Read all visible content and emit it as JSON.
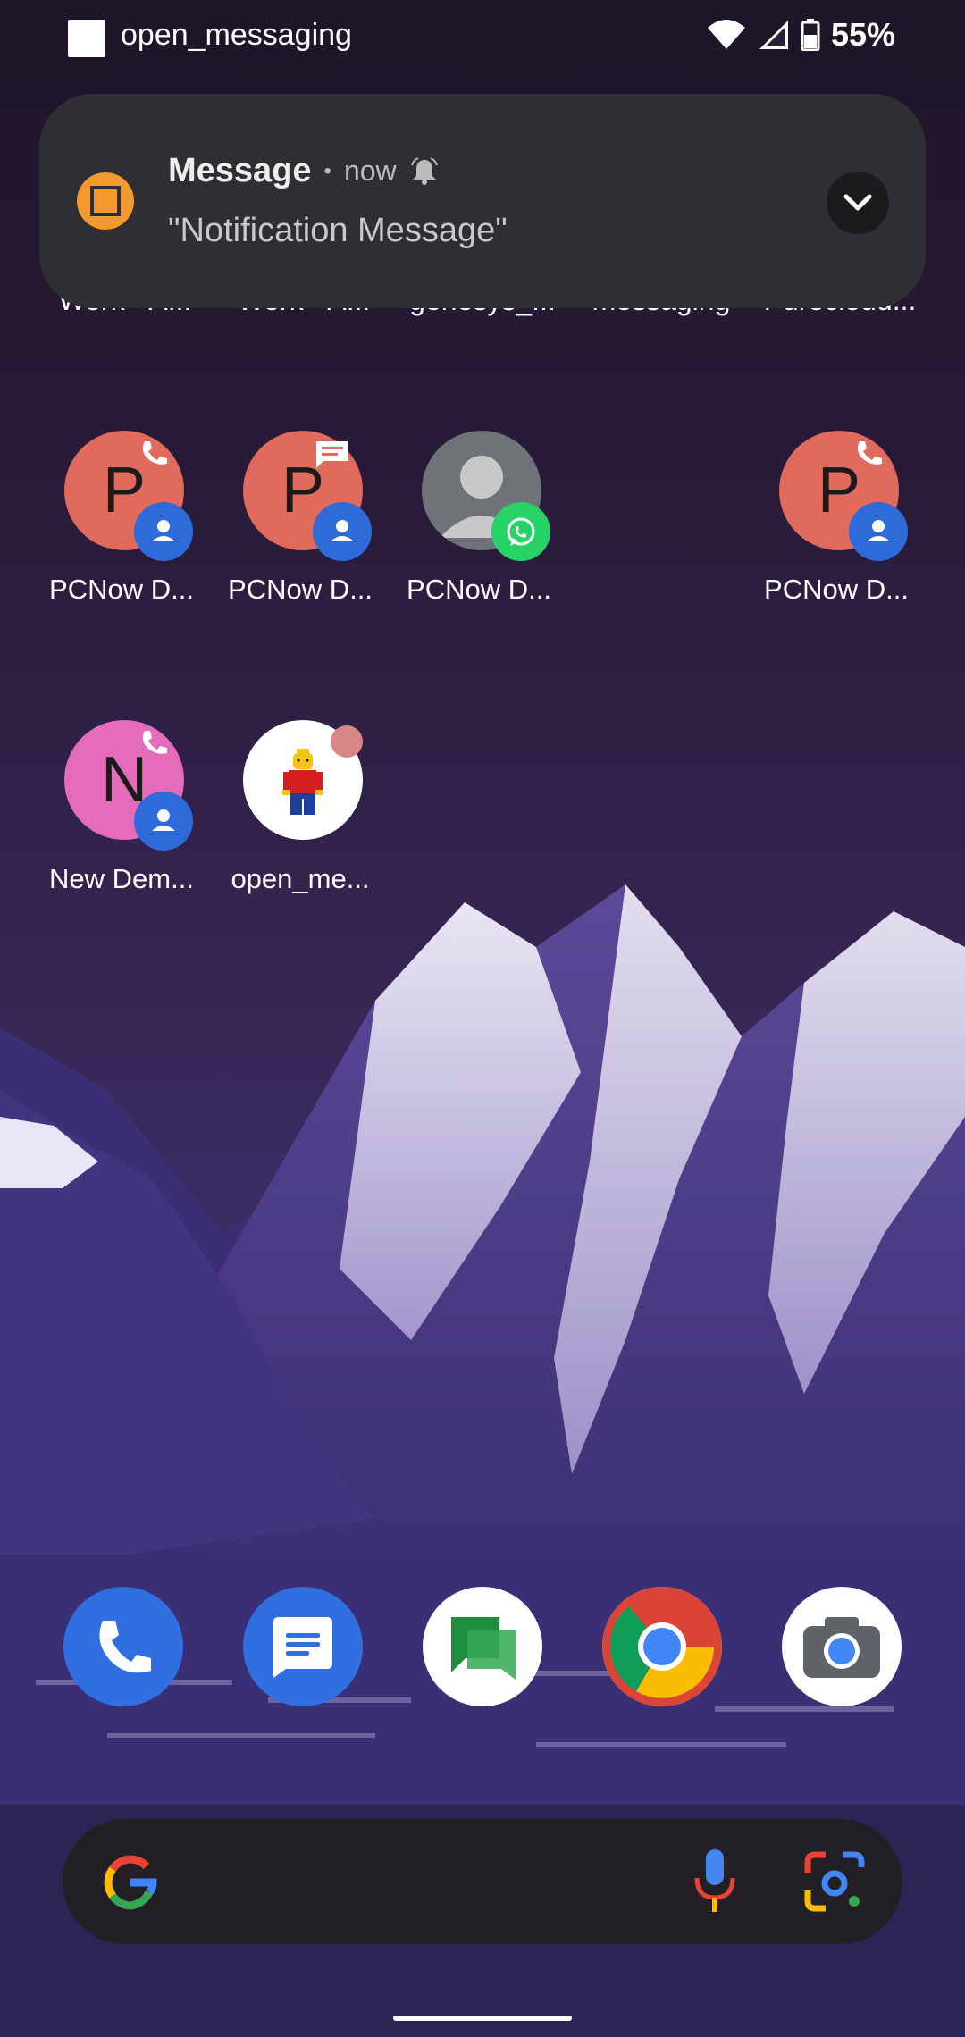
{
  "status_bar": {
    "app_name": "open_messaging",
    "battery": "55%",
    "icons": [
      "app-square-icon",
      "wifi-icon",
      "cellular-icon",
      "battery-icon"
    ]
  },
  "notification": {
    "title": "Message",
    "separator": "•",
    "time": "now",
    "body": "\"Notification Message\"",
    "icon_color": "#f29a2e",
    "icons": [
      "notification-app-icon",
      "bell-icon",
      "chevron-down-icon"
    ]
  },
  "hidden_row": {
    "labels": [
      "Work - A...",
      "Work - A...",
      "genesys_...",
      "messaging",
      "Purecloud..."
    ]
  },
  "home_grid": {
    "row1": [
      {
        "letter": "P",
        "label": "PCNow D...",
        "color": "#e06a5c",
        "badge": "phone"
      },
      {
        "letter": "P",
        "label": "PCNow D...",
        "color": "#e06a5c",
        "badge": "message"
      },
      {
        "letter": "",
        "label": "PCNow D...",
        "color": "#6e7378",
        "badge": "whatsapp"
      },
      {
        "letter": "P",
        "label": "PCNow D...",
        "color": "#e06a5c",
        "badge": "phone"
      }
    ],
    "row2": [
      {
        "letter": "N",
        "label": "New Dem...",
        "color": "#e56bbb",
        "badge": "phone"
      },
      {
        "letter": "",
        "label": "open_me...",
        "color": "#ffffff",
        "badge": "notification-dot"
      }
    ]
  },
  "dock": {
    "apps": [
      "phone-app-icon",
      "messages-app-icon",
      "google-chat-app-icon",
      "chrome-app-icon",
      "camera-app-icon"
    ]
  },
  "search_bar": {
    "icons": [
      "google-g-icon",
      "microphone-icon",
      "google-lens-icon"
    ]
  },
  "colors": {
    "accent_blue": "#2f6bd8",
    "whatsapp_green": "#25d366",
    "notification_bg": "#2f2f33"
  }
}
